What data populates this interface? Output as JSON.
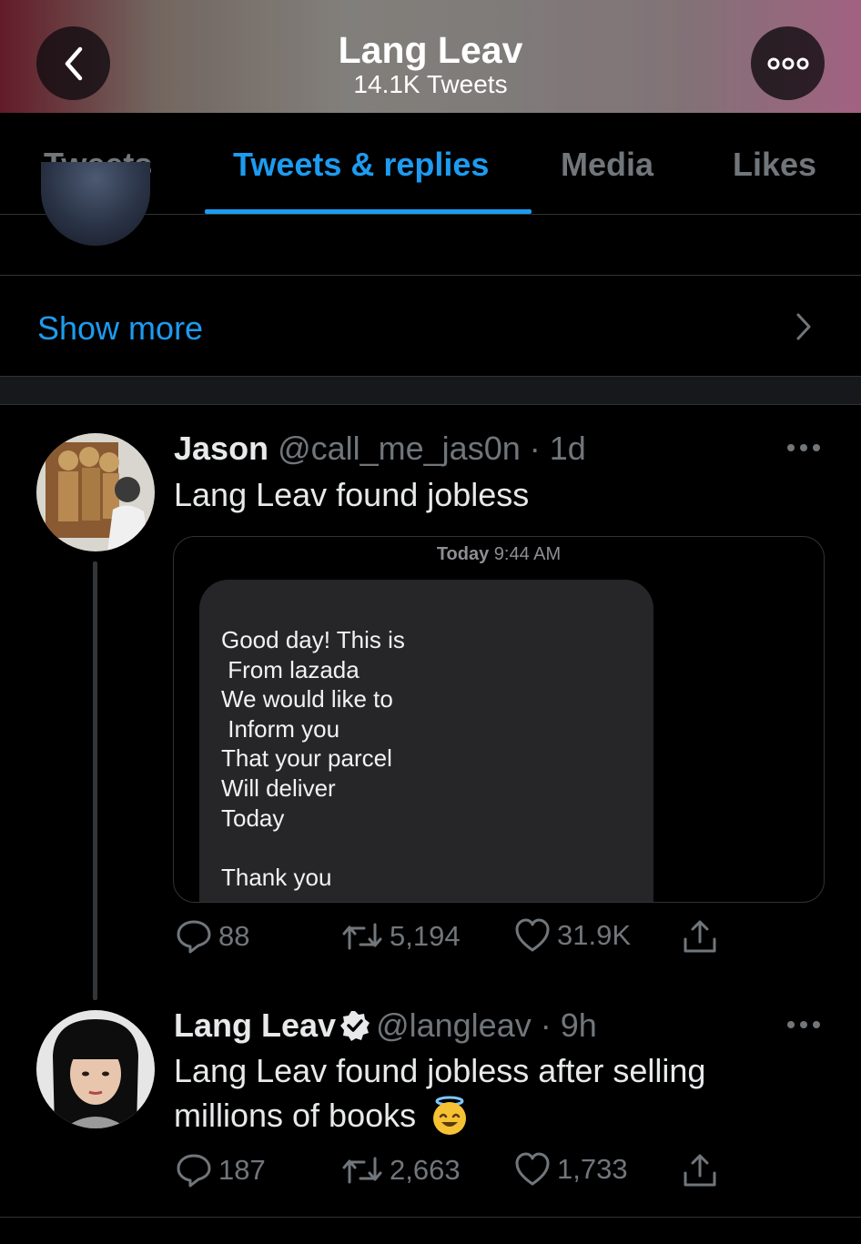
{
  "header": {
    "title": "Lang Leav",
    "subtitle": "14.1K Tweets"
  },
  "tabs": [
    {
      "label": "Tweets",
      "active": false
    },
    {
      "label": "Tweets & replies",
      "active": true
    },
    {
      "label": "Media",
      "active": false
    },
    {
      "label": "Likes",
      "active": false
    }
  ],
  "show_more": {
    "label": "Show more"
  },
  "tweets": [
    {
      "name": "Jason",
      "handle": "@call_me_jas0n",
      "time": "· 1d",
      "text": "Lang Leav found jobless",
      "media": {
        "timestamp_prefix": "Today",
        "timestamp_time": "9:44 AM",
        "message": "Good day! This is\n From lazada\nWe would like to\n Inform you\nThat your parcel\nWill deliver\nToday\n\nThank you"
      },
      "stats": {
        "replies": "88",
        "retweets": "5,194",
        "likes": "31.9K"
      }
    },
    {
      "name": "Lang Leav",
      "verified": true,
      "handle": "@langleav",
      "time": "· 9h",
      "text_line1": "Lang Leav found jobless after selling",
      "text_line2": "millions of books",
      "emoji": "smiling-face-with-halo",
      "stats": {
        "replies": "187",
        "retweets": "2,663",
        "likes": "1,733"
      }
    }
  ],
  "colors": {
    "accent": "#1d9bf0",
    "muted": "#71767b",
    "text": "#e7e9ea",
    "background": "#000000"
  }
}
